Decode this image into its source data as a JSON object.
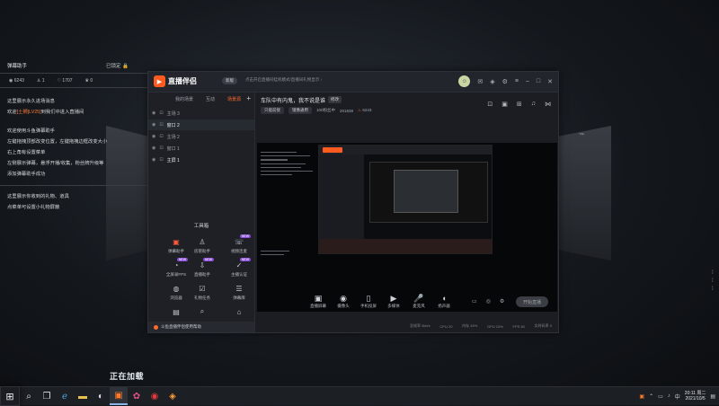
{
  "barrage": {
    "title": "弹幕助手",
    "pin": "已锁定",
    "stats": [
      "6243",
      "1",
      "1707",
      "0"
    ],
    "lines": [
      "这里展示永久进场消息",
      "欢迎",
      "[土狮]LV25]",
      "到我们中进入直播间",
      "欢迎使用斗鱼弹幕助手",
      "左键拖拽顶部改变位置，左键拖拽边框改变大小",
      "右上角有设置菜单",
      "左侧展示弹幕，悬浮开播/收集，粉丝牌升级等",
      "添加弹幕助手成功",
      "这里展示你收到的礼物、道具",
      "点菜单可设置小礼物屏蔽"
    ]
  },
  "app": {
    "name": "直播伴侣",
    "version": "新版",
    "marquee": "点击开启直播间挂机模式/直播间礼物显示 ›",
    "left_tabs": [
      "我的场景",
      "互动",
      "场景源"
    ],
    "scenes": [
      {
        "label": "主场 3",
        "active": false
      },
      {
        "label": "窗口 2",
        "active": true
      },
      {
        "label": "主场 2",
        "active": false
      },
      {
        "label": "窗口 1",
        "active": false
      },
      {
        "label": "主屏 1",
        "active": true
      }
    ],
    "tools_title": "工具箱",
    "tools": [
      {
        "label": "弹幕助手",
        "icon": "▣",
        "red": true,
        "badge": ""
      },
      {
        "label": "房管助手",
        "icon": "♙",
        "red": false,
        "badge": ""
      },
      {
        "label": "视频连麦",
        "icon": "☏",
        "red": false,
        "badge": "NEW"
      },
      {
        "label": "全屏录FPS",
        "icon": "◔",
        "red": false,
        "badge": "NEW"
      },
      {
        "label": "直播助手",
        "icon": "⇩",
        "red": false,
        "badge": "NEW"
      },
      {
        "label": "主播认证",
        "icon": "✓",
        "red": false,
        "badge": "NEW"
      },
      {
        "label": "浏览器",
        "icon": "◍",
        "red": false,
        "badge": ""
      },
      {
        "label": "礼物任务",
        "icon": "☑",
        "red": false,
        "badge": ""
      },
      {
        "label": "弹幕库",
        "icon": "☰",
        "red": false,
        "badge": ""
      },
      {
        "label": "",
        "icon": "▤",
        "red": false,
        "badge": ""
      },
      {
        "label": "",
        "icon": "⌕",
        "red": false,
        "badge": ""
      },
      {
        "label": "",
        "icon": "⌂",
        "red": false,
        "badge": ""
      }
    ],
    "notice": "斗鱼直播伴侣使用帮助",
    "room_title": "车队中有内鬼，我不说是谁",
    "room_edit": "修改",
    "room_tags": [
      "只能前接",
      "镜像通用",
      "100粉丝中",
      "201838",
      "6243"
    ],
    "controls": [
      "直播屏幕",
      "摄像头",
      "手机投屏",
      "多媒体",
      "麦克风",
      "扬声器"
    ],
    "start_label": "开始直播",
    "status": [
      "丢帧率 0kb/s",
      "CPU 20",
      "内存 45%",
      "GPU 10%",
      "FPS 60",
      "实时码率 0"
    ]
  },
  "loading_text": "正在加载",
  "taskbar": {
    "time": "20:11 周二",
    "date": "2021/10/5"
  }
}
